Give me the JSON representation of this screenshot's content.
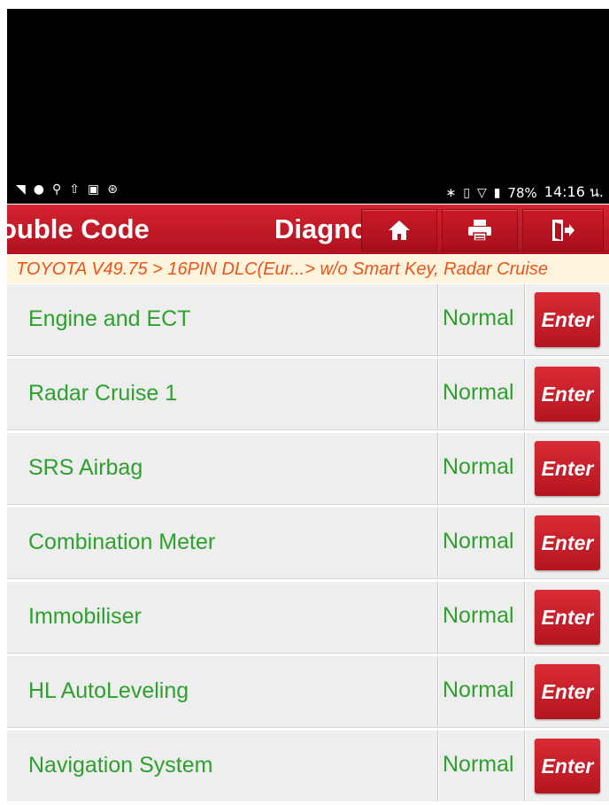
{
  "status_bar": {
    "battery": "78%",
    "time": "14:16 น."
  },
  "header": {
    "title_fragment": "ouble Code",
    "title_fragment2": "Diagnosis",
    "buttons": [
      {
        "icon": "home-icon"
      },
      {
        "icon": "print-icon"
      },
      {
        "icon": "exit-icon"
      }
    ]
  },
  "breadcrumb": "TOYOTA V49.75 > 16PIN DLC(Eur...> w/o Smart Key, Radar Cruise",
  "systems": [
    {
      "name": "Engine and ECT",
      "status": "Normal",
      "action": "Enter"
    },
    {
      "name": "Radar Cruise 1",
      "status": "Normal",
      "action": "Enter"
    },
    {
      "name": "SRS Airbag",
      "status": "Normal",
      "action": "Enter"
    },
    {
      "name": "Combination Meter",
      "status": "Normal",
      "action": "Enter"
    },
    {
      "name": "Immobiliser",
      "status": "Normal",
      "action": "Enter"
    },
    {
      "name": "HL AutoLeveling",
      "status": "Normal",
      "action": "Enter"
    },
    {
      "name": "Navigation System",
      "status": "Normal",
      "action": "Enter"
    }
  ],
  "colors": {
    "header_red": "#c41a26",
    "status_green": "#2ea02e",
    "breadcrumb_orange": "#e8541c",
    "breadcrumb_bg": "#fff5dc"
  }
}
